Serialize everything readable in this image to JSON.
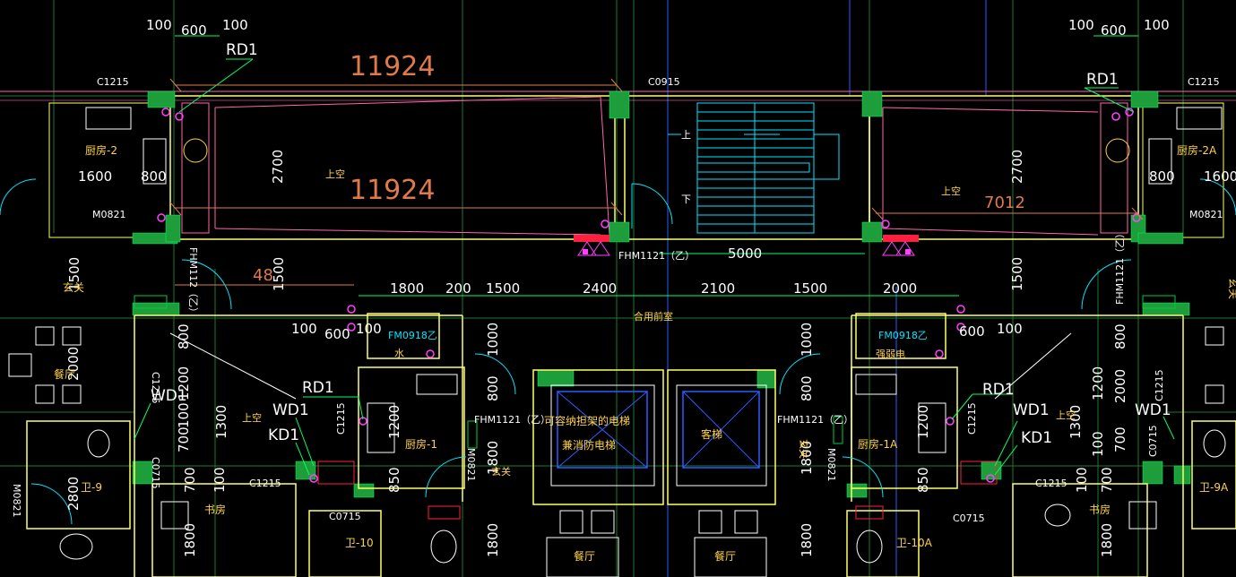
{
  "colors": {
    "background": "#000000",
    "wall": "#ffff66",
    "column": "#1e9e3a",
    "grid_green": "#1f7a2a",
    "grid_blue": "#2c5cff",
    "dimension": "#e07a4a",
    "stairs": "#00e5ff",
    "hatch_red": "#ff2040",
    "fixture_magenta": "#ff40ff",
    "label_yellow": "#ffd24a",
    "label_white": "#ffffff",
    "pink_line": "#ff66aa"
  },
  "dims": {
    "top_left": [
      "100",
      "600",
      "100"
    ],
    "top_right": [
      "100",
      "600",
      "100"
    ],
    "span_top": "11924",
    "span_mid": "11924",
    "span_right": "7012",
    "height_2700_left": "2700",
    "height_2700_right": "2700",
    "width_1600_left": "1600",
    "width_800_left": "800",
    "width_1600_right": "1600",
    "width_800_right": "800",
    "lobby_5000": "5000",
    "row_1800": "1800",
    "row_200": "200",
    "row_1500a": "1500",
    "row_2400": "2400",
    "row_2100": "2100",
    "row_1500b": "1500",
    "row_2000": "2000",
    "left_1500": "1500",
    "right_1500": "1500",
    "left_48": "48",
    "left_100": "100",
    "left_600": "600",
    "left_100b": "100",
    "right_600": "600",
    "right_100": "100",
    "v_800": "800",
    "v_2000": "2000",
    "v_1200": "1200",
    "v_1300": "1300",
    "v_100": "100",
    "v_700": "700",
    "v_2800": "2800",
    "v_1000": "1000",
    "v_800b": "800",
    "v_1200b": "1200",
    "v_850": "850",
    "v_1800a": "1800",
    "v_1800b": "1800",
    "v_1000r": "1000",
    "v_800r": "800",
    "v_1200r": "1200",
    "v_850r": "850",
    "v_1800r": "1800",
    "v_800rr": "800",
    "v_1200rr": "1200",
    "v_1300rr": "1300",
    "v_100rr": "100",
    "v_700rr": "700",
    "v_1800bl": "1800",
    "v_700bl": "700",
    "v_100bl": "100",
    "v_1800br": "1800",
    "v_700br": "700",
    "v_100br": "100",
    "v_1800bc": "1800",
    "v_2000r": "2000",
    "v_1500": "1500"
  },
  "tags": {
    "rd1_top_left": "RD1",
    "rd1_top_right": "RD1",
    "rd1_mid_left": "RD1",
    "rd1_mid_right": "RD1",
    "wd1_a": "WD1",
    "wd1_b": "WD1",
    "wd1_c": "WD1",
    "wd1_d": "WD1",
    "kd1_left": "KD1",
    "kd1_right": "KD1"
  },
  "windows": {
    "c1215_tl": "C1215",
    "c0915": "C0915",
    "c1215_tr": "C1215",
    "c1215_ml": "C1215",
    "c1215_mr": "C1215",
    "c1215_bl": "C1215",
    "c1215_br": "C1215",
    "c0715_l": "C0715",
    "c0715_r": "C0715",
    "c0715_vl": "C0715",
    "c0715_vr": "C0715",
    "c1215_vl": "C1215",
    "c1215_vr": "C1215"
  },
  "doors": {
    "m0821_tl": "M0821",
    "m0821_tr": "M0821",
    "m0821_ml": "M0821",
    "m0821_mr": "M0821",
    "m0821_side": "M0821",
    "fhm1121_top": "FHM1121（乙）",
    "fhm112_left": "FHM112（乙）",
    "fhm1121_right": "FHM1121（乙）",
    "fhm1121_l2": "FHM1121（乙）",
    "fhm1121_r2": "FHM1121（乙）",
    "fm0918_l": "FM0918乙",
    "fm0918_r": "FM0918乙"
  },
  "rooms": {
    "kitchen2": "厨房-2",
    "kitchen2a": "厨房-2A",
    "void_left": "上空",
    "void_right": "上空",
    "void_mid_left": "上空",
    "void_mid_right": "上空",
    "foyer_left": "玄关",
    "foyer_right": "玄关",
    "foyer_center": "玄关",
    "foyer_center_r": "玄关",
    "dining_left": "餐厅",
    "dining_c1": "餐厅",
    "dining_c2": "餐厅",
    "shared_lobby": "合用前室",
    "water": "水",
    "strong_elec": "强弱电",
    "kitchen1": "厨房-1",
    "kitchen1a": "厨房-1A",
    "elevator_fire_1": "可容纳担架的电梯",
    "elevator_fire_2": "兼消防电梯",
    "elevator_passenger": "客梯",
    "study_left": "书房",
    "study_right": "书房",
    "bath9": "卫-9",
    "bath9a": "卫-9A",
    "bath10": "卫-10",
    "bath10a": "卫-10A",
    "stair_up": "上",
    "stair_down": "下"
  }
}
